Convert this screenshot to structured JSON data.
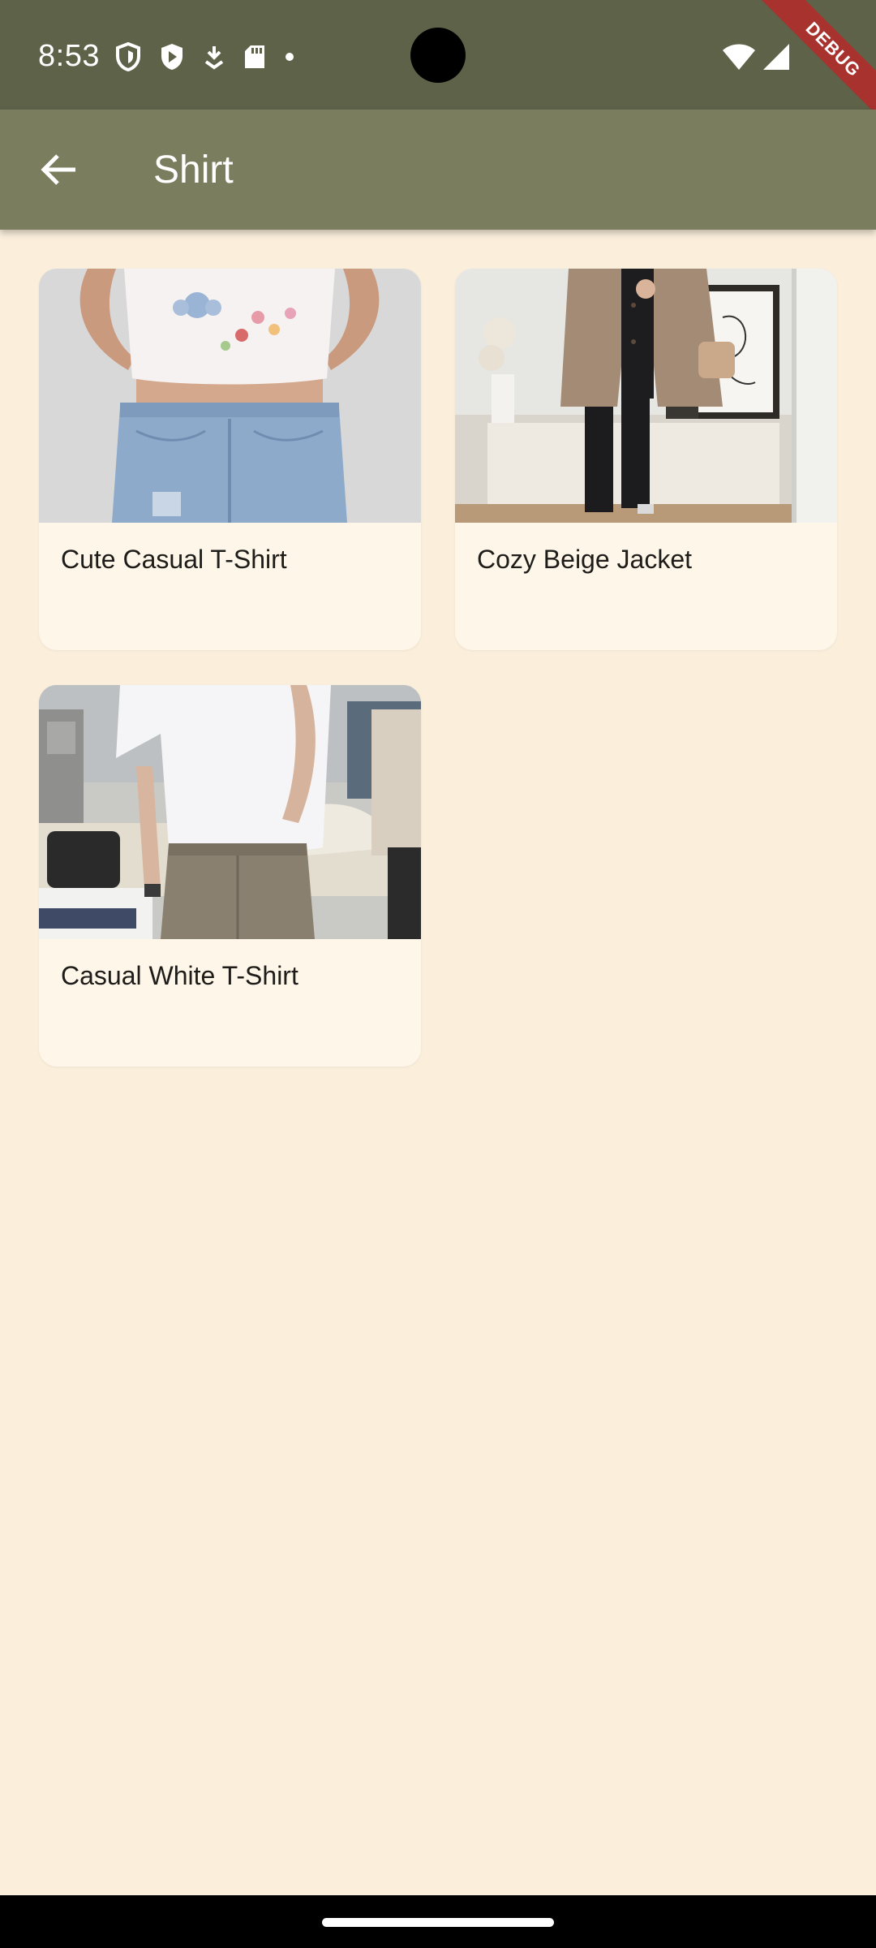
{
  "status_bar": {
    "time": "8:53",
    "left_icons": [
      "shield-outline-icon",
      "shield-play-icon",
      "download-arrow-icon",
      "sd-card-icon",
      "dot-icon"
    ],
    "right_icons": [
      "wifi-icon",
      "signal-icon"
    ]
  },
  "debug_banner": {
    "label": "DEBUG"
  },
  "app_bar": {
    "back_icon": "arrow-back-icon",
    "title": "Shirt"
  },
  "items": [
    {
      "name": "Cute Casual T-Shirt",
      "image": "cropped white graphic t-shirt with jeans"
    },
    {
      "name": "Cozy Beige Jacket",
      "image": "beige shacket with black leggings"
    },
    {
      "name": "Casual White T-Shirt",
      "image": "white t-shirt with grey trousers"
    }
  ],
  "colors": {
    "status_bar": "#5E6249",
    "app_bar": "#7A7E5E",
    "background": "#FBEFDC",
    "card": "#FFF6EA",
    "debug": "#A8322E"
  }
}
